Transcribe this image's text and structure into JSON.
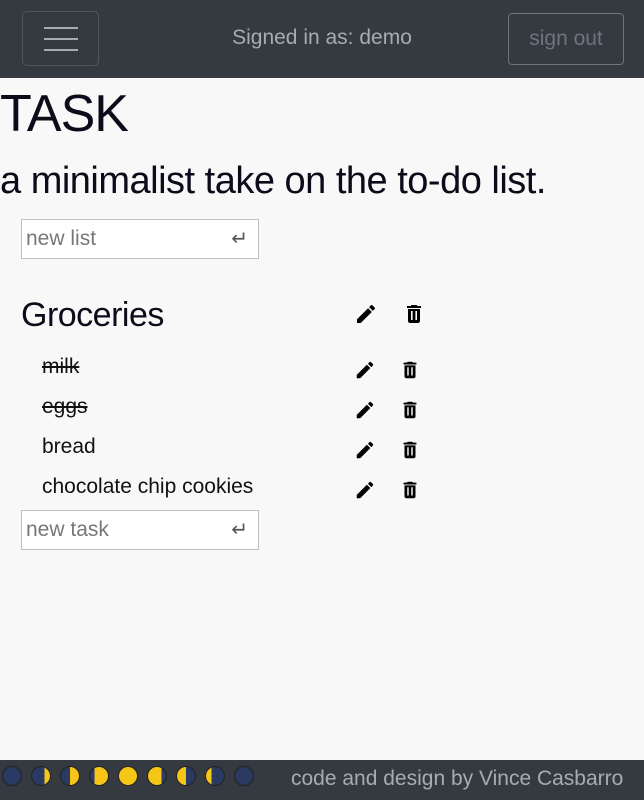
{
  "navbar": {
    "signed_in_text": "Signed in as: demo",
    "signout_label": "sign out"
  },
  "header": {
    "title": "TASK",
    "subtitle": "a minimalist take on the to-do list."
  },
  "new_list": {
    "placeholder": "new list"
  },
  "list": {
    "name": "Groceries",
    "tasks": [
      {
        "text": "milk",
        "done": true
      },
      {
        "text": "eggs",
        "done": true
      },
      {
        "text": "bread",
        "done": false
      },
      {
        "text": "chocolate chip cookies",
        "done": false
      }
    ],
    "new_task_placeholder": "new task"
  },
  "footer": {
    "credit": "code and design by Vince Casbarro",
    "moon_phases": [
      "new",
      "waxing-crescent",
      "first-quarter",
      "waxing-gibbous",
      "full",
      "waning-gibbous",
      "last-quarter",
      "waning-crescent",
      "new"
    ]
  },
  "colors": {
    "navbar_bg": "#343a40",
    "page_bg": "#f8f8f8",
    "moon_dark": "#2b3a63",
    "moon_light": "#f5c518"
  }
}
